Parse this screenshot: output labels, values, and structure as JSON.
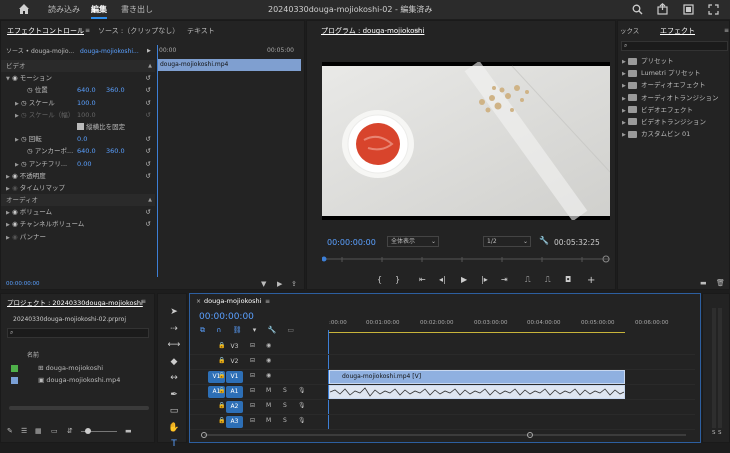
{
  "topbar": {
    "home": "home-icon",
    "tabs": [
      "読み込み",
      "編集",
      "書き出し"
    ],
    "active": 1,
    "title": "20240330douga-mojiokoshi-02 - 編集済み"
  },
  "effect_controls": {
    "tabs": [
      "エフェクトコントロール",
      "ソース :（クリップなし）",
      "テキスト"
    ],
    "source": "ソース • douga-mojio...",
    "clip": "douga-mojiokoshi...",
    "tc_start": "00:00",
    "tc_end": "00:05:00",
    "clip_label": "douga-mojiokoshi.mp4",
    "video": "ビデオ",
    "motion": "モーション",
    "position": "位置",
    "pos_x": "640.0",
    "pos_y": "360.0",
    "scale": "スケール",
    "scale_v": "100.0",
    "scale_w": "スケール（幅）",
    "scale_w_v": "100.0",
    "uniform": "縦横比を固定",
    "rotation": "回転",
    "rot_v": "0.0",
    "anchor": "アンカーポ...",
    "anc_x": "640.0",
    "anc_y": "360.0",
    "antiflicker": "アンチフリ...",
    "af_v": "0.00",
    "opacity": "不透明度",
    "timeremap": "タイムリマップ",
    "audio": "オーディオ",
    "volume": "ボリューム",
    "chvolume": "チャンネルボリューム",
    "panner": "パンナー",
    "timecode": "00:00:00:00"
  },
  "program": {
    "title": "プログラム : douga-mojiokoshi",
    "timecode": "00:00:00:00",
    "fit": "全体表示",
    "res": "1/2",
    "duration": "00:05:32:25"
  },
  "effects": {
    "tabs": [
      "ックス",
      "エフェクト"
    ],
    "items": [
      "プリセット",
      "Lumetri プリセット",
      "オーディオエフェクト",
      "オーディオトランジション",
      "ビデオエフェクト",
      "ビデオトランジション",
      "カスタムビン 01"
    ]
  },
  "project": {
    "title": "プロジェクト : 20240330douga-mojiokoshi",
    "file": "20240330douga-mojiokoshi-02.prproj",
    "col_name": "名前",
    "items": [
      {
        "name": "douga-mojiokoshi",
        "color": "#4fb04a"
      },
      {
        "name": "douga-mojiokoshi.mp4",
        "color": "#7aa0d6"
      }
    ]
  },
  "timeline": {
    "tab": "douga-mojiokoshi",
    "timecode": "00:00:00:00",
    "ruler": [
      ":00:00",
      "00:01:00:00",
      "00:02:00:00",
      "00:03:00:00",
      "00:04:00:00",
      "00:05:00:00",
      "00:06:00:00"
    ],
    "tracks": [
      {
        "n": "V3"
      },
      {
        "n": "V2"
      },
      {
        "n": "V1"
      },
      {
        "n": "A1"
      },
      {
        "n": "A2"
      },
      {
        "n": "A3"
      }
    ],
    "video_clip": "douga-mojiokoshi.mp4 [V]",
    "mute": "M",
    "solo": "S"
  }
}
